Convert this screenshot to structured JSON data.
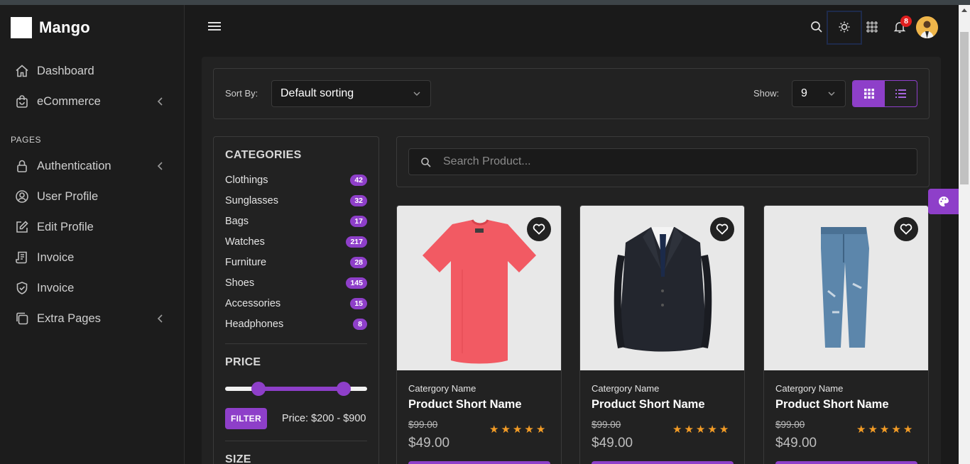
{
  "brand": {
    "name": "Mango"
  },
  "sidebar": {
    "items": [
      {
        "label": "Dashboard",
        "icon": "home-icon"
      },
      {
        "label": "eCommerce",
        "icon": "shopping-bag-icon",
        "has_submenu": true
      }
    ],
    "section_label": "PAGES",
    "pages": [
      {
        "label": "Authentication",
        "icon": "lock-icon",
        "has_submenu": true
      },
      {
        "label": "User Profile",
        "icon": "user-circle-icon"
      },
      {
        "label": "Edit Profile",
        "icon": "edit-icon"
      },
      {
        "label": "Invoice",
        "icon": "receipt-icon"
      },
      {
        "label": "Invoice",
        "icon": "shield-icon"
      },
      {
        "label": "Extra Pages",
        "icon": "copy-icon",
        "has_submenu": true
      }
    ]
  },
  "header": {
    "notification_count": "8",
    "icons": [
      "search-icon",
      "sun-icon",
      "apps-grid-icon",
      "bell-icon",
      "avatar"
    ]
  },
  "toolbar": {
    "sort_label": "Sort By:",
    "sort_value": "Default sorting",
    "show_label": "Show:",
    "show_value": "9"
  },
  "filters": {
    "categories_title": "CATEGORIES",
    "categories": [
      {
        "name": "Clothings",
        "count": "42"
      },
      {
        "name": "Sunglasses",
        "count": "32"
      },
      {
        "name": "Bags",
        "count": "17"
      },
      {
        "name": "Watches",
        "count": "217"
      },
      {
        "name": "Furniture",
        "count": "28"
      },
      {
        "name": "Shoes",
        "count": "145"
      },
      {
        "name": "Accessories",
        "count": "15"
      },
      {
        "name": "Headphones",
        "count": "8"
      }
    ],
    "price_title": "PRICE",
    "filter_button": "FILTER",
    "price_text": "Price: $200 - $900",
    "size_title": "SIZE"
  },
  "search": {
    "placeholder": "Search Product..."
  },
  "products": [
    {
      "category": "Catergory Name",
      "name": "Product Short Name",
      "old_price": "$99.00",
      "price": "$49.00",
      "rating": 5,
      "image": "red-tshirt"
    },
    {
      "category": "Catergory Name",
      "name": "Product Short Name",
      "old_price": "$99.00",
      "price": "$49.00",
      "rating": 5,
      "image": "black-suit"
    },
    {
      "category": "Catergory Name",
      "name": "Product Short Name",
      "old_price": "$99.00",
      "price": "$49.00",
      "rating": 5,
      "image": "blue-jeans"
    }
  ],
  "colors": {
    "accent": "#8e3fc9",
    "star": "#f39c26",
    "badge": "#e01e1e"
  }
}
